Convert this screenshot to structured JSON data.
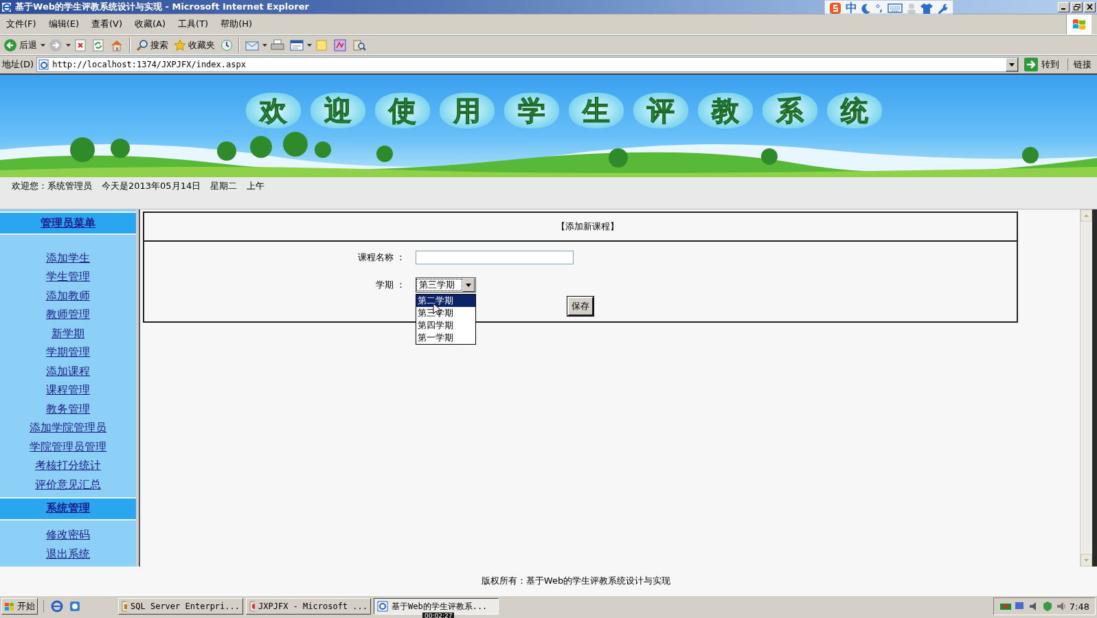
{
  "window": {
    "title": "基于Web的学生评教系统设计与实现 - Microsoft Internet Explorer"
  },
  "ime_bar": {
    "mode": "中"
  },
  "menu": [
    "文件(F)",
    "编辑(E)",
    "查看(V)",
    "收藏(A)",
    "工具(T)",
    "帮助(H)"
  ],
  "toolbar": [
    {
      "kind": "back",
      "label": "后退"
    },
    {
      "kind": "caret"
    },
    {
      "kind": "forward"
    },
    {
      "kind": "caret"
    },
    {
      "kind": "stop"
    },
    {
      "kind": "refresh"
    },
    {
      "kind": "home"
    },
    {
      "kind": "separator"
    },
    {
      "kind": "search",
      "label": "搜索"
    },
    {
      "kind": "favorites",
      "label": "收藏夹"
    },
    {
      "kind": "history"
    },
    {
      "kind": "separator"
    },
    {
      "kind": "mail"
    },
    {
      "kind": "caret"
    },
    {
      "kind": "print"
    },
    {
      "kind": "edit"
    },
    {
      "kind": "caret"
    },
    {
      "kind": "note"
    },
    {
      "kind": "discuss"
    },
    {
      "kind": "research"
    }
  ],
  "address": {
    "label": "地址(D)",
    "url": "http://localhost:1374/JXPJFX/index.aspx",
    "go": "转到",
    "links": "链接"
  },
  "banner": {
    "title": "欢迎使用学生评教系统"
  },
  "welcome": {
    "user": "欢迎您：系统管理员",
    "date": "今天是2013年05月14日",
    "weekday": "星期二",
    "period": "上午"
  },
  "sidebar": {
    "sections": [
      {
        "title": "管理员菜单",
        "items": [
          "添加学生",
          "学生管理",
          "添加教师",
          "教师管理",
          "新学期",
          "学期管理",
          "添加课程",
          "课程管理",
          "教务管理",
          "添加学院管理员",
          "学院管理员管理",
          "考核打分统计",
          "评价意见汇总"
        ]
      },
      {
        "title": "系统管理",
        "items": [
          "修改密码",
          "退出系统"
        ]
      }
    ]
  },
  "form": {
    "title": "【添加新课程】",
    "fields": [
      {
        "kind": "text",
        "label": "课程名称 ："
      },
      {
        "kind": "select",
        "label": "学期 ：",
        "value": "第三学期",
        "expanded": true,
        "options": [
          {
            "label": "第二学期",
            "highlighted": true
          },
          {
            "label": "第三学期",
            "highlighted": false
          },
          {
            "label": "第四学期",
            "highlighted": false
          },
          {
            "label": "第一学期",
            "highlighted": false
          }
        ]
      }
    ],
    "save": "保存"
  },
  "footer": "版权所有：基于Web的学生评教系统设计与实现",
  "taskbar": {
    "start": "开始",
    "tasks": [
      {
        "label": "SQL Server Enterpri...",
        "kind": "console",
        "active": false
      },
      {
        "label": "JXPJFX - Microsoft ...",
        "kind": "studio",
        "active": false
      },
      {
        "label": "基于Web的学生评教系...",
        "kind": "browser",
        "active": true
      }
    ],
    "clock": "7:48"
  },
  "recording_timer": "00:02:27"
}
